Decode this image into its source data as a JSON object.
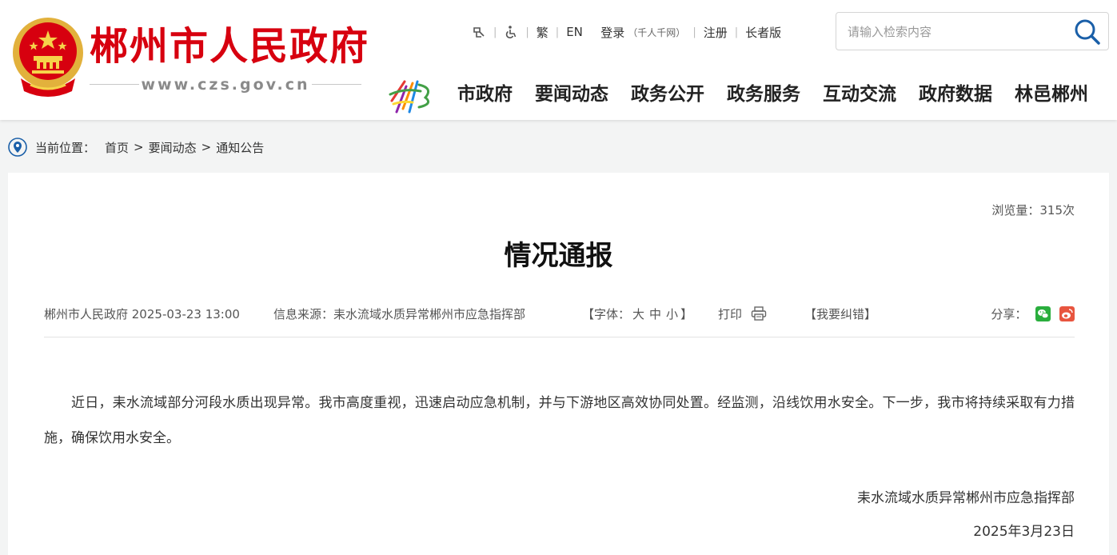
{
  "header": {
    "site_title": "郴州市人民政府",
    "site_url": "www.czs.gov.cn",
    "toolbar": {
      "accessibility_icon": "wheelchair-icon",
      "traditional_label": "繁",
      "english_label": "EN",
      "login_label": "登录",
      "login_note": "（千人千网）",
      "register_label": "注册",
      "elder_label": "长者版"
    },
    "search": {
      "placeholder": "请输入检索内容",
      "icon": "search-icon"
    },
    "nav": [
      "市政府",
      "要闻动态",
      "政务公开",
      "政务服务",
      "互动交流",
      "政府数据",
      "林邑郴州"
    ]
  },
  "breadcrumb": {
    "label": "当前位置：",
    "items": [
      "首页",
      "要闻动态",
      "通知公告"
    ],
    "separator": ">"
  },
  "article": {
    "views": "浏览量：315次",
    "title": "情况通报",
    "publisher_date": "郴州市人民政府 2025-03-23 13:00",
    "source": "信息来源：耒水流域水质异常郴州市应急指挥部",
    "font_prefix": "【字体：",
    "font_large": "大",
    "font_medium": "中",
    "font_small": "小",
    "font_suffix": "】",
    "print_label": "打印",
    "correction_label": "【我要纠错】",
    "share_label": "分享：",
    "body": "近日，耒水流域部分河段水质出现异常。我市高度重视，迅速启动应急机制，并与下游地区高效协同处置。经监测，沿线饮用水安全。下一步，我市将持续采取有力措施，确保饮用水安全。",
    "sign_org": "耒水流域水质异常郴州市应急指挥部",
    "sign_date": "2025年3月23日"
  },
  "colors": {
    "brand_red": "#d7000f",
    "wechat_green": "#2aae3d",
    "weibo_red": "#e8553f"
  }
}
